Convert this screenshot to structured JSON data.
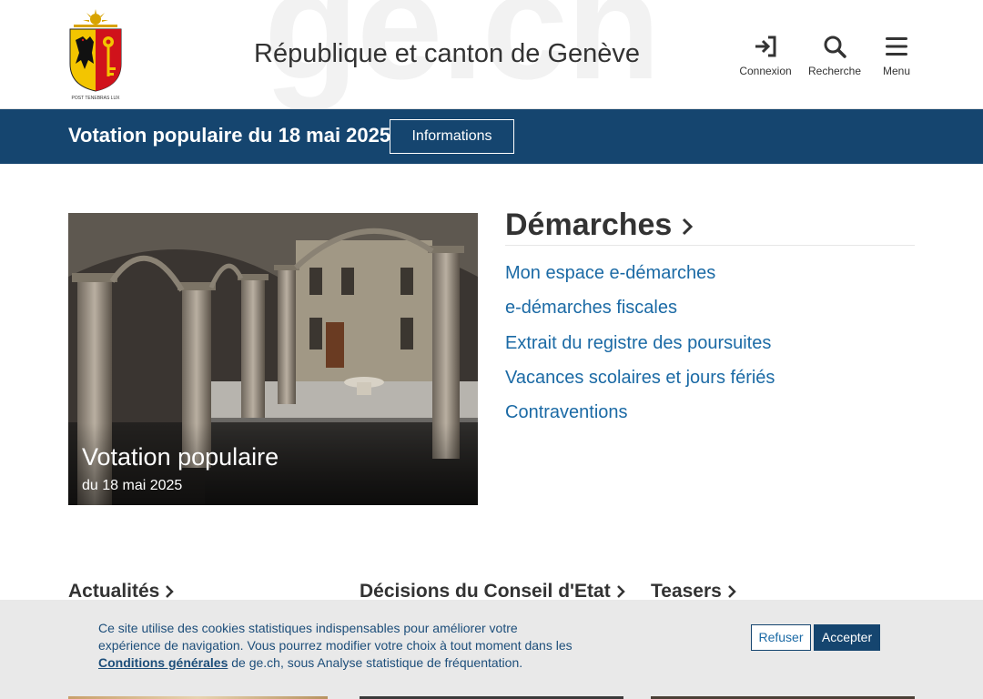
{
  "header": {
    "watermark": "ge.ch",
    "title": "République et canton de Genève",
    "logo_motto": "POST TENEBRAS LUX",
    "actions": [
      {
        "label": "Connexion",
        "icon": "sign-in-icon"
      },
      {
        "label": "Recherche",
        "icon": "search-icon"
      },
      {
        "label": "Menu",
        "icon": "hamburger-menu-icon"
      }
    ]
  },
  "banner": {
    "title": "Votation populaire du 18 mai 2025",
    "button_label": "Informations"
  },
  "hero": {
    "title": "Votation populaire",
    "date": "du 18 mai 2025"
  },
  "demarches": {
    "heading": "Démarches",
    "links": [
      "Mon espace e-démarches",
      "e-démarches fiscales",
      "Extrait du registre des poursuites",
      "Vacances scolaires et jours fériés",
      "Contraventions"
    ]
  },
  "sections": [
    {
      "label": "Actualités"
    },
    {
      "label": "Décisions du Conseil d'Etat"
    },
    {
      "label": "Teasers"
    }
  ],
  "cookie": {
    "text_before": "Ce site utilise des cookies statistiques indispensables pour améliorer votre expérience de navigation. Vous pourrez modifier votre choix à tout moment dans les ",
    "link_label": "Conditions générales",
    "text_after": " de ge.ch, sous Analyse statistique de fréquentation.",
    "refuse_label": "Refuser",
    "accept_label": "Accepter"
  },
  "colors": {
    "banner_bg": "#15456f",
    "link": "#1b6aa5",
    "cookie_bg": "#e9e9e9",
    "accept_bg": "#15456f"
  }
}
